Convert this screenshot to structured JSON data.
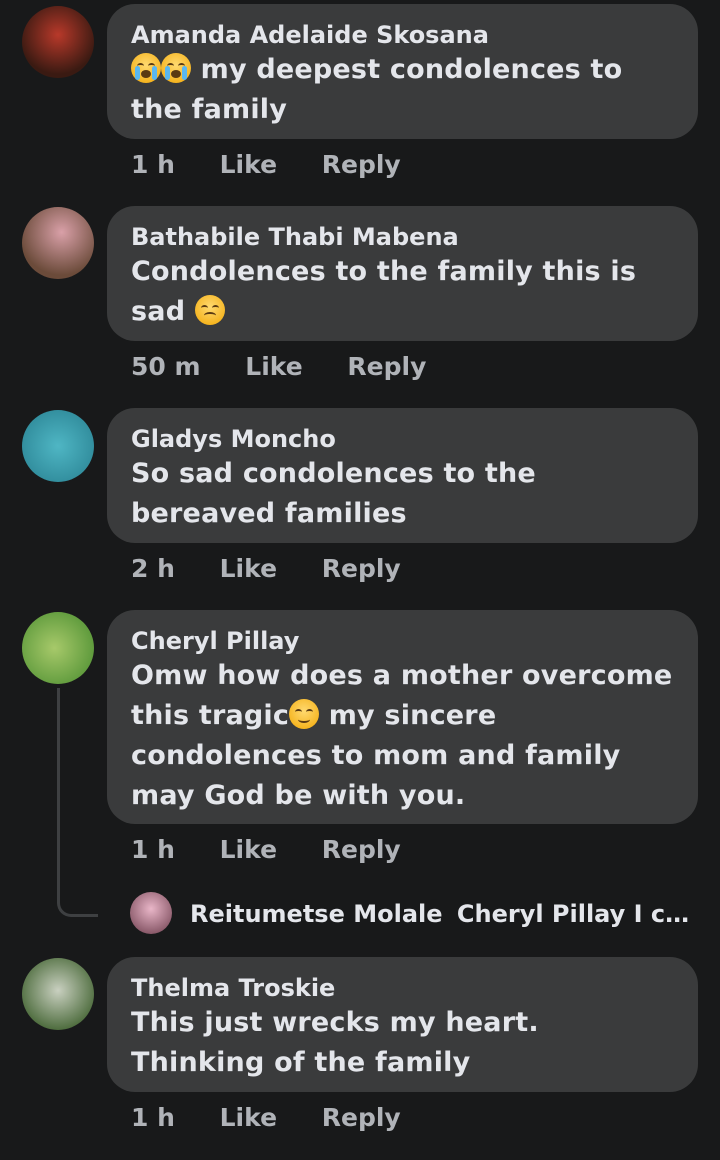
{
  "comments": [
    {
      "author": "Amanda Adelaide Skosana",
      "text_line1": "my deepest condolences to",
      "text_line2": "the family",
      "emoji_prefix": [
        "loudly-crying-face",
        "loudly-crying-face"
      ],
      "time": "1 h",
      "like": "Like",
      "reply": "Reply",
      "avatar_colors": [
        "#3a1a12",
        "#b8392a"
      ]
    },
    {
      "author": "Bathabile Thabi Mabena",
      "text_line1": "Condolences to the family this is",
      "text_line2": "sad",
      "emoji_suffix": "pensive-face",
      "time": "50 m",
      "like": "Like",
      "reply": "Reply",
      "avatar_colors": [
        "#6b4b3a",
        "#d9a0a8"
      ]
    },
    {
      "author": "Gladys Moncho",
      "text_line1": "So sad condolences to the",
      "text_line2": "bereaved families",
      "time": "2 h",
      "like": "Like",
      "reply": "Reply",
      "avatar_colors": [
        "#4fb6c4",
        "#2f8a9a"
      ]
    },
    {
      "author": "Cheryl Pillay",
      "text_line1": "Omw how does a mother overcome",
      "text_line2a": "this tragic",
      "text_line2b": "my sincere",
      "text_line3": "condolences to mom and family",
      "text_line4": "may God be with you.",
      "emoji_inline": "sad-face",
      "time": "1 h",
      "like": "Like",
      "reply": "Reply",
      "avatar_colors": [
        "#5e9a3c",
        "#a7c96a"
      ]
    },
    {
      "author": "Thelma Troskie",
      "text_line1": "This just wrecks my heart.",
      "text_line2": "Thinking of the family",
      "time": "1 h",
      "like": "Like",
      "reply": "Reply",
      "avatar_colors": [
        "#4c6b3c",
        "#c9d0c0"
      ]
    }
  ],
  "reply_preview": {
    "author": "Reitumetse Molale",
    "text": "Cheryl Pillay I ca..."
  }
}
